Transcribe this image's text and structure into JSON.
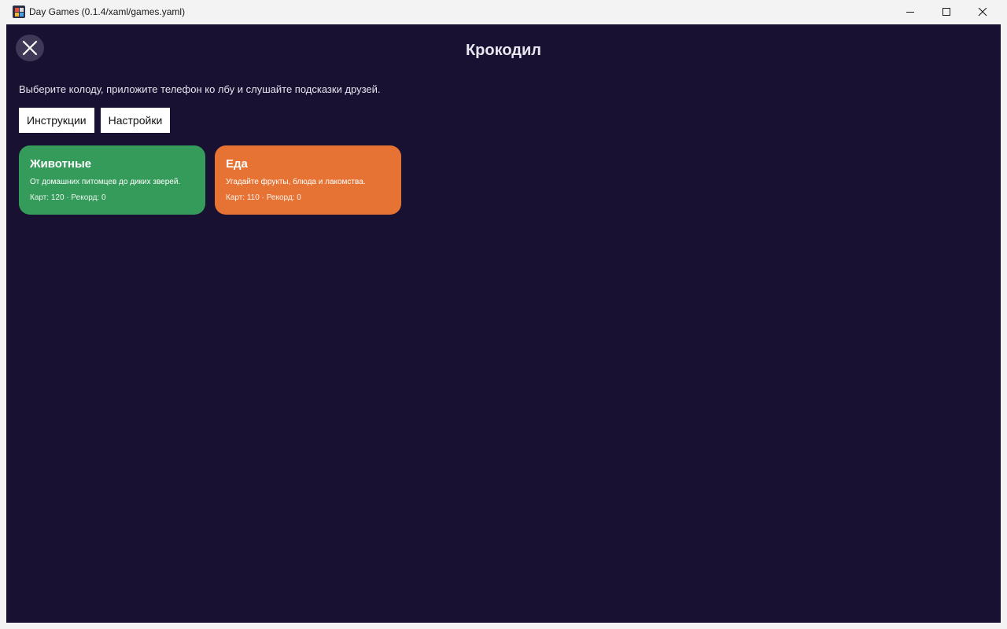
{
  "window": {
    "title": "Day Games (0.1.4/xaml/games.yaml)"
  },
  "header": {
    "title": "Крокодил",
    "back_icon": "close-icon"
  },
  "subtitle": "Выберите колоду, приложите телефон ко лбу и слушайте подсказки друзей.",
  "toolbar": {
    "instructions_label": "Инструкции",
    "settings_label": "Настройки"
  },
  "decks": [
    {
      "name": "Животные",
      "description": "От домашних питомцев до диких зверей.",
      "meta": "Карт: 120 · Рекорд: 0",
      "color": "#349b5a"
    },
    {
      "name": "Еда",
      "description": "Угадайте фрукты, блюда и лакомства.",
      "meta": "Карт: 110 · Рекорд: 0",
      "color": "#e67334"
    }
  ],
  "colors": {
    "background": "#181132",
    "titlebar": "#f3f3f3"
  }
}
